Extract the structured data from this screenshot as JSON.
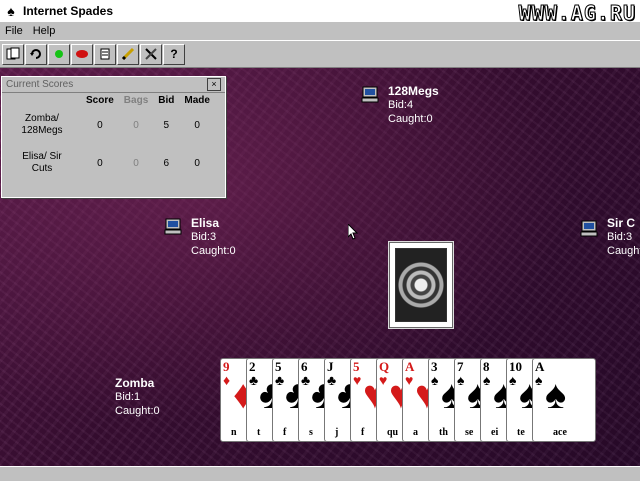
{
  "window": {
    "title": "Internet Spades",
    "watermark": "WWW.AG.RU"
  },
  "menu": [
    {
      "label": "File"
    },
    {
      "label": "Help"
    }
  ],
  "toolbar": {
    "buttons": [
      {
        "icon": "new-game-icon"
      },
      {
        "icon": "refresh-icon"
      },
      {
        "icon": "green-light-icon"
      },
      {
        "icon": "red-light-icon"
      },
      {
        "icon": "scroll-icon"
      },
      {
        "icon": "pencil-icon"
      },
      {
        "icon": "tools-icon"
      },
      {
        "icon": "help-icon",
        "glyph": "?"
      }
    ]
  },
  "scores": {
    "title": "Current Scores",
    "close": "×",
    "headers": [
      "Score",
      "Bags",
      "Bid",
      "Made"
    ],
    "rows": [
      {
        "team": "Zomba/ 128Megs",
        "score": "0",
        "bags": "0",
        "bid": "5",
        "made": "0"
      },
      {
        "team": "Elisa/ Sir Cuts",
        "score": "0",
        "bags": "0",
        "bid": "6",
        "made": "0"
      }
    ]
  },
  "players": {
    "north": {
      "name": "128Megs",
      "bid": "Bid:4",
      "caught": "Caught:0"
    },
    "west": {
      "name": "Elisa",
      "bid": "Bid:3",
      "caught": "Caught:0"
    },
    "east": {
      "name": "Sir C",
      "bid": "Bid:3",
      "caught": "Caught:"
    },
    "south": {
      "name": "Zomba",
      "bid": "Bid:1",
      "caught": "Caught:0"
    }
  },
  "hand": [
    {
      "rank": "9",
      "suit": "diamonds",
      "suit_glyph": "♦",
      "word": "n",
      "color": "#d41a1a"
    },
    {
      "rank": "2",
      "suit": "clubs",
      "suit_glyph": "♣",
      "word": "t",
      "color": "#000000"
    },
    {
      "rank": "5",
      "suit": "clubs",
      "suit_glyph": "♣",
      "word": "f",
      "color": "#000000"
    },
    {
      "rank": "6",
      "suit": "clubs",
      "suit_glyph": "♣",
      "word": "s",
      "color": "#000000"
    },
    {
      "rank": "J",
      "suit": "clubs",
      "suit_glyph": "♣",
      "word": "j",
      "color": "#000000"
    },
    {
      "rank": "5",
      "suit": "hearts",
      "suit_glyph": "♥",
      "word": "f",
      "color": "#d41a1a"
    },
    {
      "rank": "Q",
      "suit": "hearts",
      "suit_glyph": "♥",
      "word": "qu",
      "color": "#d41a1a"
    },
    {
      "rank": "A",
      "suit": "hearts",
      "suit_glyph": "♥",
      "word": "a",
      "color": "#d41a1a"
    },
    {
      "rank": "3",
      "suit": "spades",
      "suit_glyph": "♠",
      "word": "th",
      "color": "#000000"
    },
    {
      "rank": "7",
      "suit": "spades",
      "suit_glyph": "♠",
      "word": "se",
      "color": "#000000"
    },
    {
      "rank": "8",
      "suit": "spades",
      "suit_glyph": "♠",
      "word": "ei",
      "color": "#000000"
    },
    {
      "rank": "10",
      "suit": "spades",
      "suit_glyph": "♠",
      "word": "te",
      "color": "#000000"
    },
    {
      "rank": "A",
      "suit": "spades",
      "suit_glyph": "♠",
      "word": "ace",
      "color": "#000000"
    }
  ],
  "colors": {
    "felt": "#3a0e34",
    "chrome": "#c0c0c0",
    "player_text": "#ffffff"
  }
}
